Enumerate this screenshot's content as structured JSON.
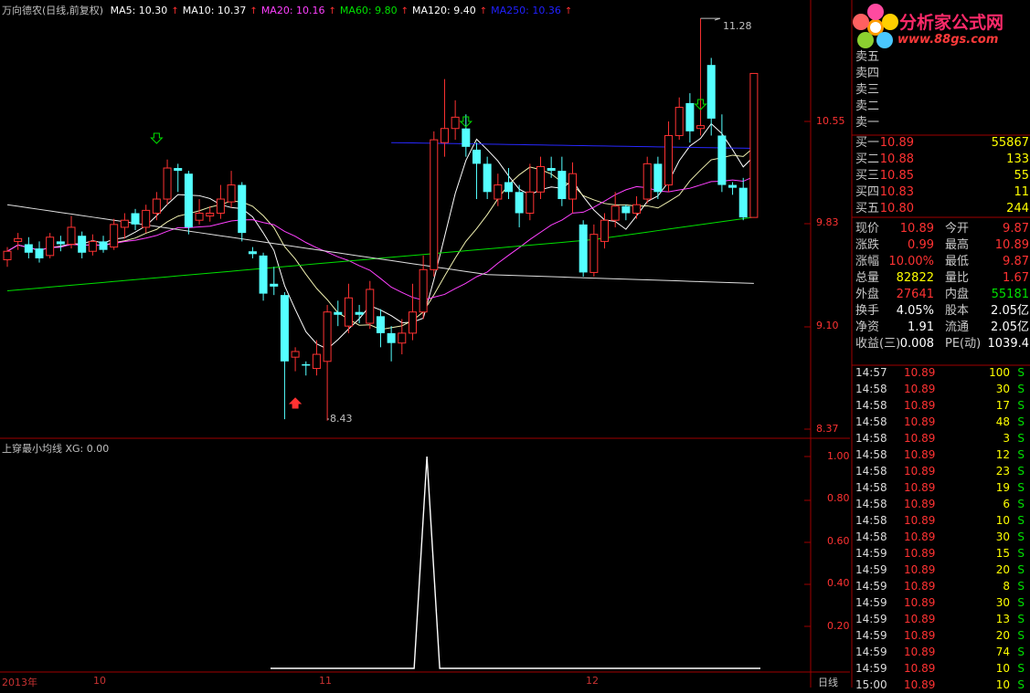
{
  "header": {
    "title": "万向德农(日线,前复权)",
    "ma": [
      {
        "label": "MA5: 10.30",
        "color": "#ffffff"
      },
      {
        "label": "MA10: 10.37",
        "color": "#ffffff"
      },
      {
        "label": "MA20: 10.16",
        "color": "#ff40ff"
      },
      {
        "label": "MA60: 9.80",
        "color": "#00e000"
      },
      {
        "label": "MA120: 9.40",
        "color": "#ffffff"
      },
      {
        "label": "MA250: 10.36",
        "color": "#2020ff"
      }
    ]
  },
  "logo": {
    "text": "分析家公式网",
    "url": "www.88gs.com"
  },
  "price_axis": [
    "10.55",
    "9.83",
    "9.10",
    "8.37"
  ],
  "annotations": {
    "high": "11.28",
    "low": "8.43"
  },
  "indicator": {
    "title": "上穿最小均线 XG: 0.00",
    "axis": [
      "1.00",
      "0.80",
      "0.60",
      "0.40",
      "0.20"
    ]
  },
  "x_axis": [
    "2013年",
    "10",
    "11",
    "12"
  ],
  "period_tab": "日线",
  "order_book": {
    "sell": [
      {
        "label": "卖五"
      },
      {
        "label": "卖四"
      },
      {
        "label": "卖三"
      },
      {
        "label": "卖二"
      },
      {
        "label": "卖一"
      }
    ],
    "buy": [
      {
        "label": "买一",
        "price": "10.89",
        "vol": "55867"
      },
      {
        "label": "买二",
        "price": "10.88",
        "vol": "133"
      },
      {
        "label": "买三",
        "price": "10.85",
        "vol": "55"
      },
      {
        "label": "买四",
        "price": "10.83",
        "vol": "11"
      },
      {
        "label": "买五",
        "price": "10.80",
        "vol": "244"
      }
    ]
  },
  "quote": [
    {
      "l1": "现价",
      "v1": "10.89",
      "c1": "red",
      "l2": "今开",
      "v2": "9.87",
      "c2": "red"
    },
    {
      "l1": "涨跌",
      "v1": "0.99",
      "c1": "red",
      "l2": "最高",
      "v2": "10.89",
      "c2": "red"
    },
    {
      "l1": "涨幅",
      "v1": "10.00%",
      "c1": "red",
      "l2": "最低",
      "v2": "9.87",
      "c2": "red"
    },
    {
      "l1": "总量",
      "v1": "82822",
      "c1": "yel",
      "l2": "量比",
      "v2": "1.67",
      "c2": "red"
    },
    {
      "l1": "外盘",
      "v1": "27641",
      "c1": "red",
      "l2": "内盘",
      "v2": "55181",
      "c2": "grn"
    },
    {
      "l1": "换手",
      "v1": "4.05%",
      "c1": "wht",
      "l2": "股本",
      "v2": "2.05亿",
      "c2": "wht"
    },
    {
      "l1": "净资",
      "v1": "1.91",
      "c1": "wht",
      "l2": "流通",
      "v2": "2.05亿",
      "c2": "wht"
    },
    {
      "l1": "收益(三)",
      "v1": "0.008",
      "c1": "wht",
      "l2": "PE(动)",
      "v2": "1039.4",
      "c2": "wht"
    }
  ],
  "ticks": [
    {
      "t": "14:57",
      "p": "10.89",
      "v": "100",
      "s": "S"
    },
    {
      "t": "14:58",
      "p": "10.89",
      "v": "30",
      "s": "S"
    },
    {
      "t": "14:58",
      "p": "10.89",
      "v": "17",
      "s": "S"
    },
    {
      "t": "14:58",
      "p": "10.89",
      "v": "48",
      "s": "S"
    },
    {
      "t": "14:58",
      "p": "10.89",
      "v": "3",
      "s": "S"
    },
    {
      "t": "14:58",
      "p": "10.89",
      "v": "12",
      "s": "S"
    },
    {
      "t": "14:58",
      "p": "10.89",
      "v": "23",
      "s": "S"
    },
    {
      "t": "14:58",
      "p": "10.89",
      "v": "19",
      "s": "S"
    },
    {
      "t": "14:58",
      "p": "10.89",
      "v": "6",
      "s": "S"
    },
    {
      "t": "14:58",
      "p": "10.89",
      "v": "10",
      "s": "S"
    },
    {
      "t": "14:58",
      "p": "10.89",
      "v": "30",
      "s": "S"
    },
    {
      "t": "14:59",
      "p": "10.89",
      "v": "15",
      "s": "S"
    },
    {
      "t": "14:59",
      "p": "10.89",
      "v": "20",
      "s": "S"
    },
    {
      "t": "14:59",
      "p": "10.89",
      "v": "8",
      "s": "S"
    },
    {
      "t": "14:59",
      "p": "10.89",
      "v": "30",
      "s": "S"
    },
    {
      "t": "14:59",
      "p": "10.89",
      "v": "13",
      "s": "S"
    },
    {
      "t": "14:59",
      "p": "10.89",
      "v": "20",
      "s": "S"
    },
    {
      "t": "14:59",
      "p": "10.89",
      "v": "74",
      "s": "S"
    },
    {
      "t": "14:59",
      "p": "10.89",
      "v": "10",
      "s": "S"
    },
    {
      "t": "15:00",
      "p": "10.89",
      "v": "10",
      "s": "S"
    }
  ],
  "candles": [
    [
      9.57,
      9.63,
      9.52,
      9.66
    ],
    [
      9.7,
      9.72,
      9.64,
      9.76
    ],
    [
      9.68,
      9.62,
      9.58,
      9.73
    ],
    [
      9.65,
      9.58,
      9.55,
      9.7
    ],
    [
      9.6,
      9.73,
      9.58,
      9.76
    ],
    [
      9.7,
      9.68,
      9.63,
      9.74
    ],
    [
      9.68,
      9.8,
      9.65,
      9.88
    ],
    [
      9.74,
      9.62,
      9.58,
      9.77
    ],
    [
      9.63,
      9.7,
      9.6,
      9.75
    ],
    [
      9.7,
      9.64,
      9.62,
      9.74
    ],
    [
      9.66,
      9.82,
      9.64,
      9.86
    ],
    [
      9.8,
      9.85,
      9.72,
      9.9
    ],
    [
      9.9,
      9.82,
      9.78,
      9.93
    ],
    [
      9.8,
      9.92,
      9.76,
      9.96
    ],
    [
      9.9,
      10.0,
      9.85,
      10.05
    ],
    [
      10.0,
      10.22,
      9.96,
      10.28
    ],
    [
      10.22,
      10.2,
      10.05,
      10.25
    ],
    [
      10.18,
      9.8,
      9.75,
      10.2
    ],
    [
      9.85,
      9.9,
      9.82,
      10.0
    ],
    [
      9.88,
      9.9,
      9.84,
      9.95
    ],
    [
      9.9,
      10.0,
      9.86,
      10.1
    ],
    [
      9.98,
      10.1,
      9.94,
      10.2
    ],
    [
      10.1,
      9.76,
      9.7,
      10.12
    ],
    [
      9.63,
      9.61,
      9.58,
      9.66
    ],
    [
      9.6,
      9.33,
      9.28,
      9.62
    ],
    [
      9.4,
      9.38,
      9.32,
      9.52
    ],
    [
      9.32,
      8.85,
      8.44,
      9.34
    ],
    [
      8.88,
      8.92,
      8.78,
      8.95
    ],
    [
      8.83,
      8.82,
      8.75,
      8.85
    ],
    [
      8.8,
      8.9,
      8.75,
      9.0
    ],
    [
      8.85,
      9.2,
      8.43,
      9.25
    ],
    [
      9.2,
      9.18,
      9.1,
      9.28
    ],
    [
      9.1,
      9.3,
      9.05,
      9.4
    ],
    [
      9.2,
      9.18,
      9.12,
      9.25
    ],
    [
      9.12,
      9.36,
      9.08,
      9.42
    ],
    [
      9.17,
      9.05,
      8.95,
      9.22
    ],
    [
      9.05,
      8.98,
      8.85,
      9.1
    ],
    [
      8.98,
      9.05,
      8.9,
      9.15
    ],
    [
      9.05,
      9.2,
      9.0,
      9.4
    ],
    [
      9.2,
      9.5,
      9.15,
      9.6
    ],
    [
      9.5,
      10.42,
      9.45,
      10.48
    ],
    [
      10.4,
      10.5,
      10.3,
      10.85
    ],
    [
      10.5,
      10.58,
      10.42,
      10.7
    ],
    [
      10.5,
      10.37,
      10.3,
      10.6
    ],
    [
      10.35,
      10.25,
      10.0,
      10.4
    ],
    [
      10.25,
      10.05,
      10.0,
      10.3
    ],
    [
      10.0,
      10.1,
      9.95,
      10.18
    ],
    [
      10.12,
      10.05,
      10.0,
      10.22
    ],
    [
      10.05,
      9.9,
      9.8,
      10.1
    ],
    [
      9.9,
      10.05,
      9.85,
      10.25
    ],
    [
      10.05,
      10.23,
      10.0,
      10.3
    ],
    [
      10.22,
      10.2,
      10.15,
      10.3
    ],
    [
      10.2,
      10.0,
      9.95,
      10.3
    ],
    [
      10.0,
      10.18,
      9.9,
      10.26
    ],
    [
      9.82,
      9.48,
      9.45,
      9.85
    ],
    [
      9.48,
      9.75,
      9.45,
      9.82
    ],
    [
      9.7,
      9.85,
      9.65,
      9.9
    ],
    [
      9.85,
      9.95,
      9.8,
      10.05
    ],
    [
      9.95,
      9.9,
      9.85,
      9.96
    ],
    [
      9.9,
      9.96,
      9.86,
      10.02
    ],
    [
      10.0,
      10.25,
      9.97,
      10.3
    ],
    [
      10.25,
      10.05,
      10.0,
      10.3
    ],
    [
      10.1,
      10.45,
      10.05,
      10.55
    ],
    [
      10.45,
      10.65,
      10.42,
      10.72
    ],
    [
      10.68,
      10.48,
      10.4,
      10.75
    ],
    [
      10.5,
      10.52,
      10.45,
      11.28
    ],
    [
      10.95,
      10.57,
      10.45,
      11.0
    ],
    [
      10.45,
      10.1,
      10.05,
      10.6
    ],
    [
      10.1,
      10.08,
      10.03,
      10.12
    ],
    [
      10.08,
      9.87,
      9.85,
      10.15
    ],
    [
      9.87,
      10.89,
      9.87,
      10.89
    ]
  ]
}
